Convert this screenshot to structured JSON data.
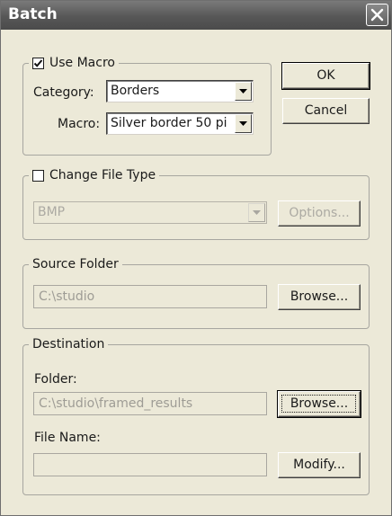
{
  "window": {
    "title": "Batch"
  },
  "use_macro": {
    "label": "Use Macro",
    "checked": true,
    "category_label": "Category:",
    "category_value": "Borders",
    "macro_label": "Macro:",
    "macro_value": "Silver border 50 pi"
  },
  "buttons": {
    "ok": "OK",
    "cancel": "Cancel"
  },
  "change_file_type": {
    "label": "Change File Type",
    "checked": false,
    "type_value": "BMP",
    "options_button": "Options..."
  },
  "source_folder": {
    "label": "Source Folder",
    "path": "C:\\studio",
    "browse_button": "Browse..."
  },
  "destination": {
    "label": "Destination",
    "folder_label": "Folder:",
    "folder_path": "C:\\studio\\framed_results",
    "browse_button": "Browse...",
    "filename_label": "File Name:",
    "filename_value": "",
    "modify_button": "Modify..."
  },
  "icons": {
    "close": "close-icon",
    "checkmark": "checkmark-icon",
    "dropdown": "chevron-down-icon"
  }
}
